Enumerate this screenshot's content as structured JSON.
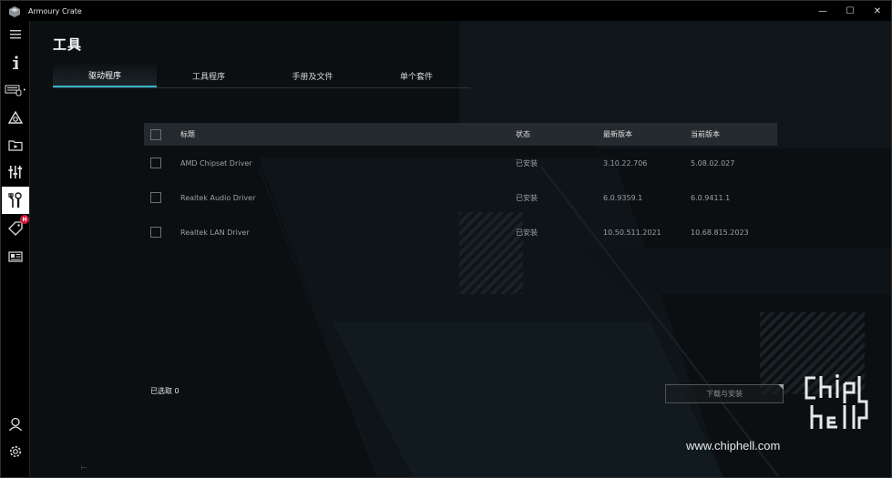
{
  "window": {
    "title": "Armoury Crate"
  },
  "title_controls": {
    "minimize": "—",
    "maximize": "☐",
    "close": "✕"
  },
  "page": {
    "title": "工具"
  },
  "tabs": [
    {
      "label": "驱动程序",
      "active": true
    },
    {
      "label": "工具程序",
      "active": false
    },
    {
      "label": "手册及文件",
      "active": false
    },
    {
      "label": "单个套件",
      "active": false
    }
  ],
  "table": {
    "headers": {
      "title": "标题",
      "status": "状态",
      "latest": "最新版本",
      "current": "当前版本"
    },
    "rows": [
      {
        "title": "AMD Chipset Driver",
        "status": "已安装",
        "latest": "3.10.22.706",
        "current": "5.08.02.027"
      },
      {
        "title": "Realtek Audio Driver",
        "status": "已安装",
        "latest": "6.0.9359.1",
        "current": "6.0.9411.1"
      },
      {
        "title": "Realtek LAN Driver",
        "status": "已安装",
        "latest": "10.50.511.2021",
        "current": "10.68.815.2023"
      }
    ]
  },
  "footer": {
    "selected": "已选取 0",
    "install_button": "下载与安装"
  },
  "sidebar": {
    "badge": "H",
    "items": [
      "menu-icon",
      "info-icon",
      "keyboard-device-icon",
      "aura-sync-icon",
      "media-folder-icon",
      "equalizer-icon",
      "tools-icon",
      "deals-tag-icon",
      "news-icon",
      "account-icon",
      "settings-icon"
    ]
  },
  "watermark": {
    "url": "www.chiphell.com"
  },
  "colors": {
    "accent": "#3ab4c8",
    "badge": "#d4143a",
    "background": "#0b0f12"
  }
}
